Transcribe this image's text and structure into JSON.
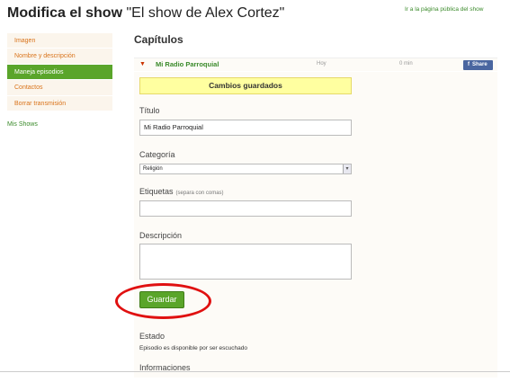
{
  "header": {
    "title_bold": "Modifica el show",
    "title_rest": " \"El show de Alex Cortez\"",
    "public_link": "Ir a la página pública del show"
  },
  "sidebar": {
    "items": [
      {
        "label": "Imagen",
        "active": false
      },
      {
        "label": "Nombre y descripción",
        "active": false
      },
      {
        "label": "Maneja episodios",
        "active": true
      },
      {
        "label": "Contactos",
        "active": false
      },
      {
        "label": "Borrar transmisión",
        "active": false
      }
    ],
    "mis_shows": "Mis Shows"
  },
  "main": {
    "section_title": "Capítulos",
    "episode": {
      "name": "Mi Radio Parroquial",
      "date": "Hoy",
      "duration": "0 min",
      "share_label": "Share"
    },
    "saved_message": "Cambios guardados",
    "form": {
      "title_label": "Título",
      "title_value": "Mi Radio Parroquial",
      "category_label": "Categoría",
      "category_value": "Religión",
      "tags_label": "Etiquetas",
      "tags_hint": "(separa con comas)",
      "tags_value": "",
      "description_label": "Descripción",
      "description_value": "",
      "save_label": "Guardar"
    },
    "estado_label": "Estado",
    "estado_text": "Episodio es disponible por ser escuchado",
    "info_label": "Informaciones"
  },
  "colors": {
    "accent_green": "#5aa52a",
    "link_orange": "#d9731a",
    "saved_bg": "#ffffa0",
    "annotation_red": "#e01010",
    "facebook_blue": "#4a66a0"
  }
}
